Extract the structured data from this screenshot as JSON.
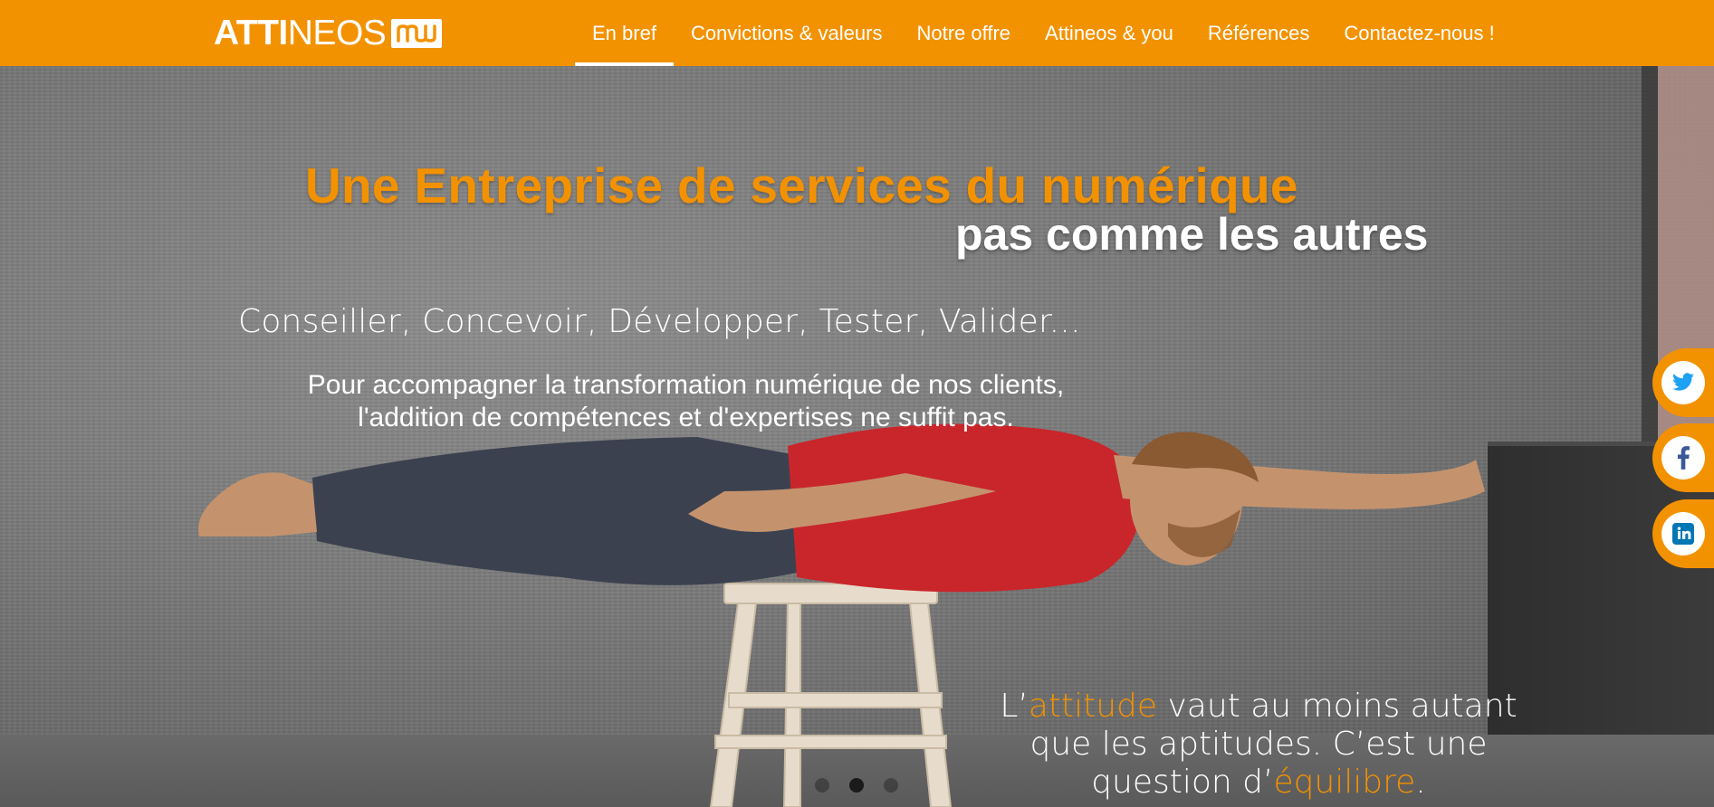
{
  "header": {
    "logo_bold": "ATTI",
    "logo_light": "NEOS",
    "logo_mark_icon": "attineos-mark-icon",
    "nav": [
      {
        "label": "En bref",
        "active": true
      },
      {
        "label": "Convictions & valeurs",
        "active": false
      },
      {
        "label": "Notre offre",
        "active": false
      },
      {
        "label": "Attineos & you",
        "active": false
      },
      {
        "label": "Références",
        "active": false
      },
      {
        "label": "Contactez-nous !",
        "active": false
      }
    ]
  },
  "hero": {
    "title_line1": "Une Entreprise de services du numérique",
    "title_line2": "pas comme les autres",
    "subtitle": "Conseiller, Concevoir, Développer, Tester, Valider...",
    "paragraph_line1": "Pour accompagner la transformation numérique de nos clients,",
    "paragraph_line2": "l'addition de compétences et d'expertises ne suffit pas.",
    "quote": {
      "part1": "L’",
      "highlight1": "attitude",
      "part2": " vaut au moins autant que les aptitudes. C’est une question d’",
      "highlight2": "équilibre",
      "part3": "."
    }
  },
  "carousel": {
    "slide_count": 3,
    "active_index": 1
  },
  "social": [
    {
      "name": "twitter",
      "icon": "twitter-icon"
    },
    {
      "name": "facebook",
      "icon": "facebook-icon"
    },
    {
      "name": "linkedin",
      "icon": "linkedin-icon"
    }
  ],
  "colors": {
    "accent": "#f39200",
    "text": "#ffffff"
  }
}
